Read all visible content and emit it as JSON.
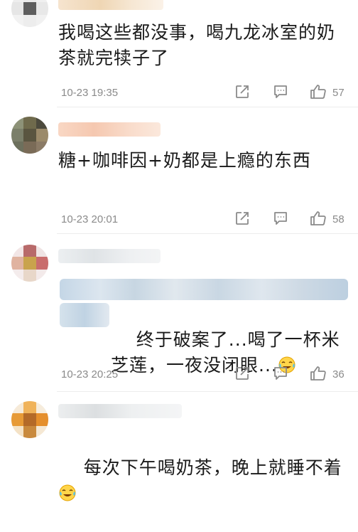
{
  "comments": [
    {
      "text": "我喝这些都没事，喝九龙冰室的奶茶就完犊子了",
      "time": "10-23 19:35",
      "likes": "57"
    },
    {
      "text": "糖+咖啡因+奶都是上瘾的东西",
      "time": "10-23 20:01",
      "likes": "58"
    },
    {
      "text": "终于破案了...喝了一杯米芝莲，一夜没闭眼...",
      "time": "10-23 20:25",
      "likes": "36",
      "emoji": "laughing-crying-emoji"
    },
    {
      "text": "每次下午喝奶茶，晚上就睡不着",
      "emoji": "laughing-crying-emoji"
    }
  ],
  "icons": {
    "share": "share-icon",
    "reply": "comment-icon",
    "like": "thumbs-up-icon"
  },
  "colors": {
    "meta_text": "#8a8a8a",
    "divider": "#ececec"
  }
}
